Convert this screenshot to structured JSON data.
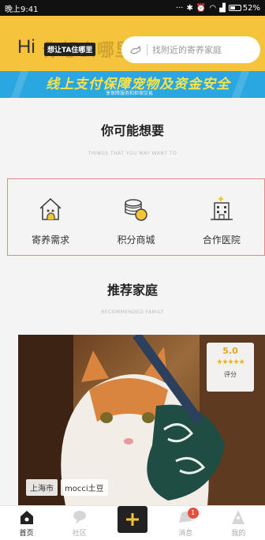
{
  "status_bar": {
    "time": "晚上9:41",
    "battery": "52%",
    "battery_level": 0.52
  },
  "header": {
    "hi": "Hi",
    "slogan_ghost": "你想去哪里？",
    "slogan_tag": "想让TA住哪里",
    "search_placeholder": "找附近的寄养家庭"
  },
  "banner": {
    "title": "线上支付保障宠物及资金安全",
    "subtitle": "享保障服务和担保交易"
  },
  "suggest": {
    "title": "你可能想要",
    "subtitle": "THINGS THAT YOU MAY WANT TO",
    "items": [
      {
        "label": "寄养需求",
        "icon": "house-pet-icon"
      },
      {
        "label": "积分商城",
        "icon": "coin-stack-icon"
      },
      {
        "label": "合作医院",
        "icon": "hospital-icon"
      }
    ]
  },
  "recommended": {
    "title": "推荐家庭",
    "subtitle": "RECOMMENDED FAMILY",
    "card": {
      "rating": "5.0",
      "stars": 5,
      "rating_label": "评分",
      "location": "上海市",
      "name": "mocci土豆"
    }
  },
  "tabbar": {
    "items": [
      {
        "label": "首页",
        "icon": "home-icon",
        "active": true
      },
      {
        "label": "社区",
        "icon": "community-icon",
        "active": false
      },
      {
        "label": "",
        "icon": "plus-icon",
        "active": false
      },
      {
        "label": "消息",
        "icon": "message-icon",
        "active": false,
        "badge": "1"
      },
      {
        "label": "我的",
        "icon": "profile-icon",
        "active": false
      }
    ]
  },
  "colors": {
    "accent": "#f6c43a",
    "banner": "#2aa6e0",
    "badge": "#e84d3d"
  }
}
